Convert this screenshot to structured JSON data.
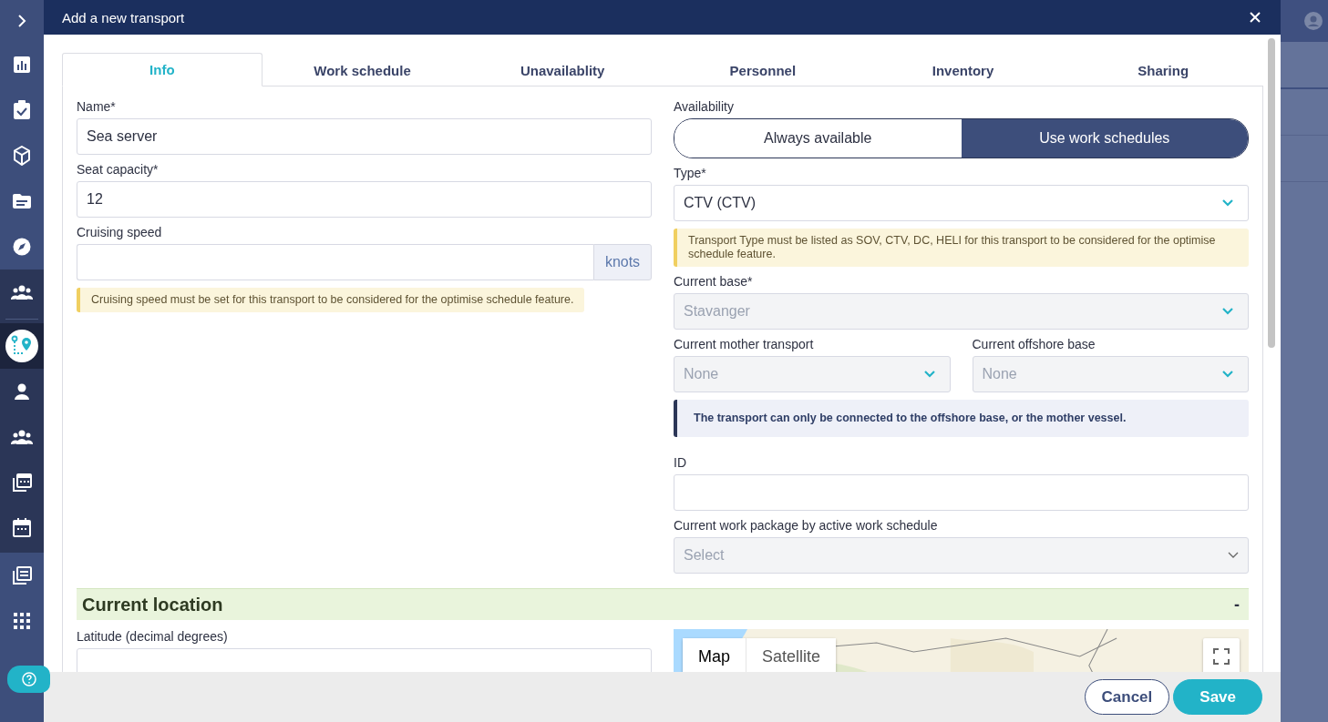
{
  "sidebar": {
    "sections": [
      {
        "dark": false,
        "items": [
          {
            "kind": "chevron",
            "selected": false
          },
          {
            "kind": "chart",
            "selected": false
          },
          {
            "kind": "clipboard",
            "selected": false
          },
          {
            "kind": "cube",
            "selected": false
          },
          {
            "kind": "folder",
            "selected": false
          },
          {
            "kind": "compass",
            "selected": false
          }
        ]
      },
      {
        "dark": true,
        "items": [
          {
            "kind": "people",
            "selected": false
          },
          {
            "kind": "route",
            "selected": true
          },
          {
            "kind": "person",
            "selected": false
          },
          {
            "kind": "people",
            "selected": false
          },
          {
            "kind": "calendar-stack",
            "selected": false
          },
          {
            "kind": "calendar",
            "selected": false
          }
        ]
      },
      {
        "dark": false,
        "items": [
          {
            "kind": "calendar-list",
            "selected": false
          },
          {
            "kind": "grid",
            "selected": false
          }
        ]
      }
    ]
  },
  "dialog": {
    "title": "Add a new transport"
  },
  "tabs": [
    {
      "label": "Info",
      "selected": true
    },
    {
      "label": "Work schedule",
      "selected": false
    },
    {
      "label": "Unavailablity",
      "selected": false
    },
    {
      "label": "Personnel",
      "selected": false
    },
    {
      "label": "Inventory",
      "selected": false
    },
    {
      "label": "Sharing",
      "selected": false
    }
  ],
  "left_fields": [
    {
      "label": "Name*",
      "value": "Sea server"
    },
    {
      "label": "Seat capacity*",
      "value": "12"
    },
    {
      "label": "Cruising speed",
      "suffix": "knots"
    }
  ],
  "cruising_note": "Cruising speed must be set for this transport to be considered for the optimise schedule feature.",
  "availability": {
    "label": "Availability",
    "options": [
      {
        "label": "Always available",
        "selected": false
      },
      {
        "label": "Use work schedules",
        "selected": true
      }
    ]
  },
  "type": {
    "label": "Type*",
    "value": "CTV (CTV)",
    "disabled": false
  },
  "type_note": "Transport Type must be listed as SOV, CTV, DC, HELI for this transport to be considered for the optimise schedule feature.",
  "current_base": {
    "label": "Current base*",
    "value": "Stavanger",
    "disabled": true
  },
  "mother_transport": {
    "label": "Current mother transport",
    "value": "None",
    "disabled": true
  },
  "offshore_base": {
    "label": "Current offshore base",
    "value": "None",
    "disabled": true
  },
  "connection_info": "The transport can only be connected to the offshore base, or the mother vessel.",
  "id_field": {
    "label": "ID"
  },
  "work_package": {
    "label": "Current work package by active work schedule",
    "placeholder": "Select",
    "disabled": true
  },
  "current_location": {
    "title": "Current location",
    "toggle": "-"
  },
  "latitude": {
    "label": "Latitude (decimal degrees)"
  },
  "map": {
    "kind": "picture",
    "types": [
      {
        "label": "Map",
        "selected": true
      },
      {
        "label": "Satellite",
        "selected": false
      }
    ]
  },
  "footer": {
    "cancel": "Cancel",
    "save": "Save"
  }
}
